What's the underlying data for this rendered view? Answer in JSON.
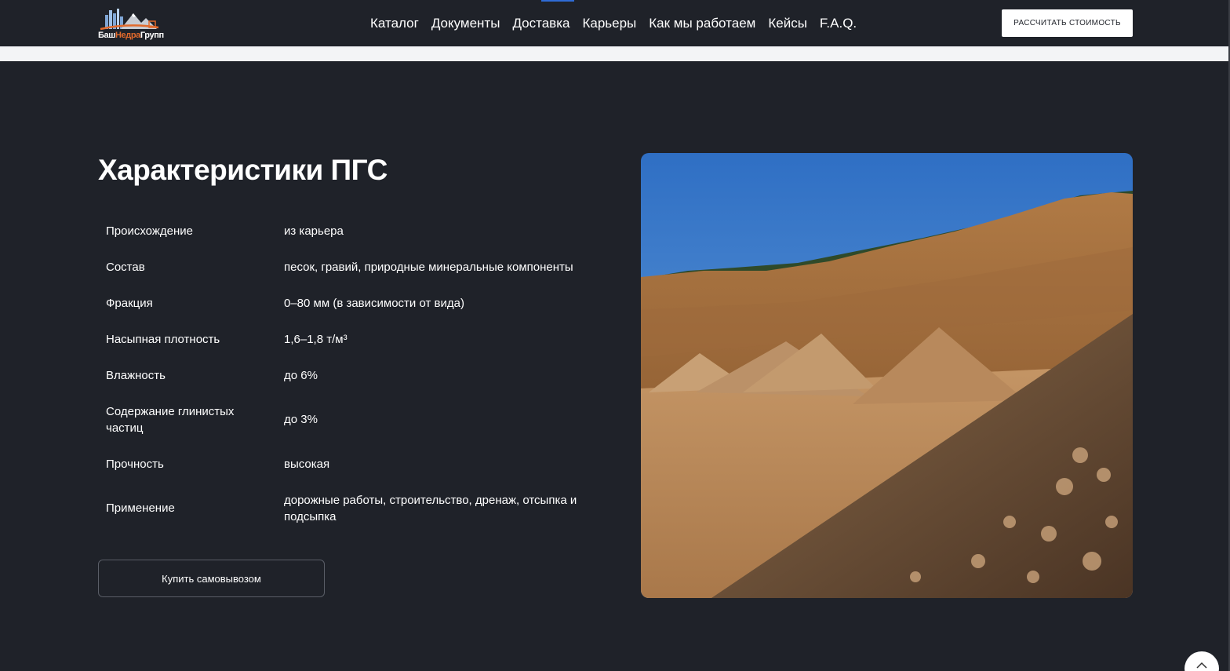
{
  "header": {
    "logo_text_part1": "Баш",
    "logo_text_accent": "Недра",
    "logo_text_part2": "Групп",
    "nav": [
      "Каталог",
      "Документы",
      "Доставка",
      "Карьеры",
      "Как мы работаем",
      "Кейсы",
      "F.A.Q."
    ],
    "cta_label": "РАССЧИТАТЬ СТОИМОСТЬ"
  },
  "main": {
    "title": "Характеристики ПГС",
    "specs": [
      {
        "key": "Происхождение",
        "value": "из карьера"
      },
      {
        "key": "Состав",
        "value": "песок, гравий, природные минеральные компоненты"
      },
      {
        "key": "Фракция",
        "value": "0–80 мм (в зависимости от вида)"
      },
      {
        "key": "Насыпная плотность",
        "value": "1,6–1,8 т/м³"
      },
      {
        "key": "Влажность",
        "value": "до 6%"
      },
      {
        "key": "Содержание глинистых частиц",
        "value": "до 3%"
      },
      {
        "key": "Прочность",
        "value": "высокая"
      },
      {
        "key": "Применение",
        "value": "дорожные работы, строительство, дренаж, отсыпка и подсыпка"
      }
    ],
    "buy_button_label": "Купить самовывозом"
  },
  "colors": {
    "background": "#1f2229",
    "accent_orange": "#e26a2c",
    "nav_indicator": "#2f6bd6",
    "cta_background": "#ffffff"
  },
  "icons": {
    "logo": "mountain-city-logo-icon",
    "scroll_top": "chevron-up-icon"
  }
}
